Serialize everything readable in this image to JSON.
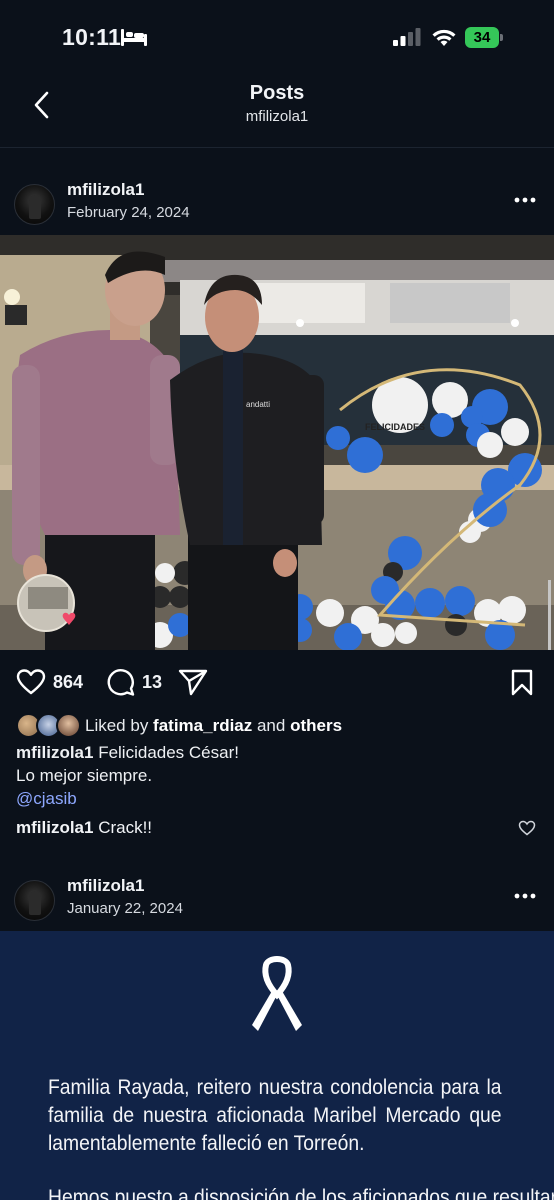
{
  "status_bar": {
    "time": "10:11",
    "battery": "34"
  },
  "header": {
    "title": "Posts",
    "subtitle": "mfilizola1"
  },
  "post1": {
    "username": "mfilizola1",
    "date": "February 24, 2024",
    "photo_text": {
      "jacket_logo": "andatti",
      "balloon_text": "FELICIDADES"
    },
    "likes": "864",
    "comments": "13",
    "liked_by_prefix": "Liked by ",
    "liked_by_user": "fatima_rdiaz",
    "liked_by_and": " and ",
    "liked_by_others": "others",
    "caption_user": "mfilizola1",
    "caption_text": " Felicidades César!",
    "caption_line2": "Lo mejor siempre.",
    "caption_mention": "@cjasib",
    "comment_user": "mfilizola1",
    "comment_text": " Crack!!"
  },
  "post2": {
    "username": "mfilizola1",
    "date": "January 22, 2024",
    "image_text": "Familia Rayada, reitero nuestra condolencia para la familia de nuestra aficionada Maribel Mercado que lamentablemente falleció en Torreón.",
    "image_text_2": "Hemos puesto a disposición de los aficionados que resultaron"
  },
  "colors": {
    "background": "#0b111a",
    "accent_link": "#8ea8ff",
    "battery": "#35c759",
    "post2_bg": "#112347"
  }
}
